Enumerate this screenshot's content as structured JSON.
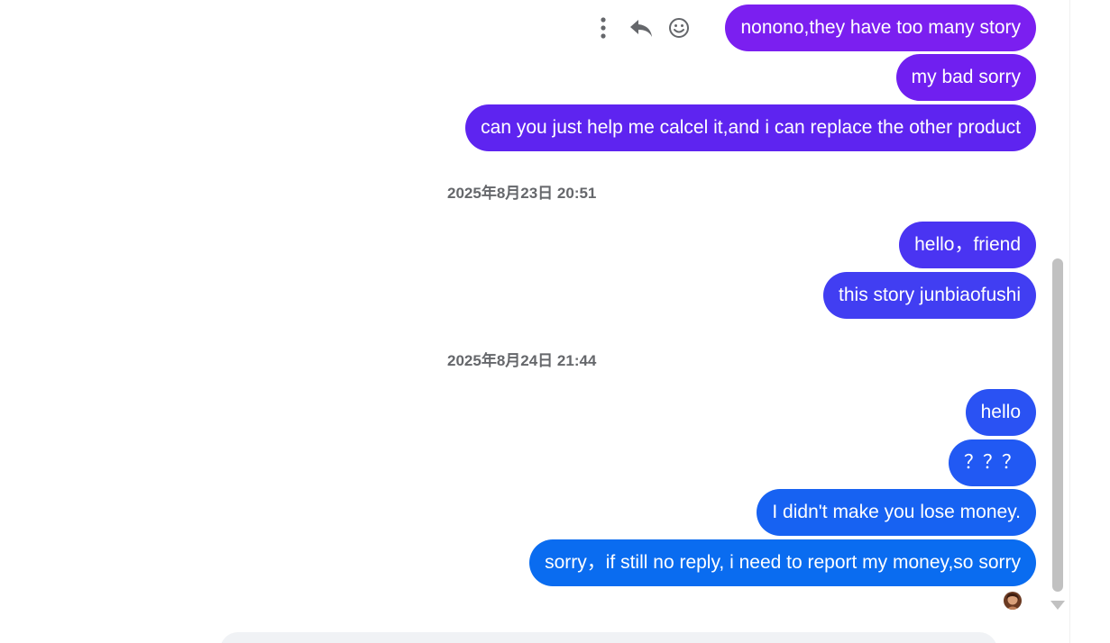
{
  "messages": [
    {
      "text": "nonono,they have too many story",
      "color": "#7b1ff0"
    },
    {
      "text": "my bad sorry",
      "color": "#701ff0"
    },
    {
      "text": "can you just help me calcel it,and i can replace the other product",
      "color": "#5e24f0"
    },
    {
      "text": "hello，friend",
      "color": "#4a34f2"
    },
    {
      "text": "this story junbiaofushi",
      "color": "#413ef2"
    },
    {
      "text": "hello",
      "color": "#2a52f3"
    },
    {
      "text": "？？？",
      "color": "#2159f3"
    },
    {
      "text": "I didn't make you lose money.",
      "color": "#1762f2"
    },
    {
      "text": "sorry，if still no reply, i need to report my money,so sorry",
      "color": "#0a6cf0"
    }
  ],
  "timestamps": [
    "2025年8月23日 20:51",
    "2025年8月24日 21:44"
  ],
  "message_actions": {
    "icons": [
      "more-options-icon",
      "reply-icon",
      "emoji-reaction-icon"
    ]
  },
  "read_receipt": {
    "icon": "seen-avatar-icon"
  },
  "colors": {
    "timestamp": "#65676b",
    "scrollbar": "#c1c1c1",
    "composer": "#f0f2f5"
  }
}
